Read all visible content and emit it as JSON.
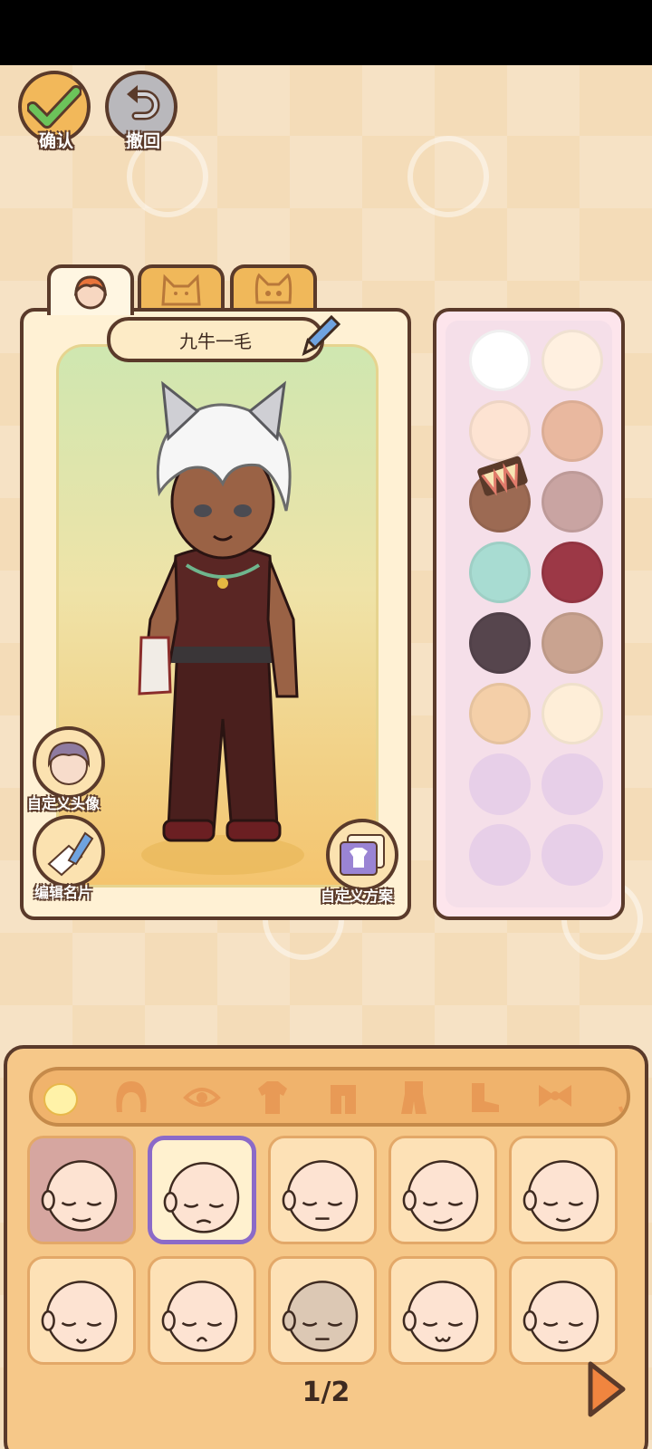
{
  "toolbar": {
    "confirm_label": "确认",
    "undo_label": "撤回"
  },
  "tabs": [
    {
      "name": "human-face-tab",
      "icon": "human-face-icon",
      "active": true
    },
    {
      "name": "cat-tab",
      "icon": "cat-face-icon",
      "active": false
    },
    {
      "name": "cat-cute-tab",
      "icon": "cat-cute-face-icon",
      "active": false
    }
  ],
  "preview": {
    "character_name": "九牛一毛",
    "custom_avatar_label": "自定义头像",
    "edit_card_label": "编辑名片",
    "custom_scheme_label": "自定义方案"
  },
  "palette": {
    "colors": [
      "#ffffff",
      "#fff0e0",
      "#fde3d2",
      "#e9b89f",
      "#9c6a53",
      "#c9a4a2",
      "#a8dcd2",
      "#9c3846",
      "#56454d",
      "#c9a390",
      "#f4cfa8",
      "#feeed8",
      "",
      "",
      "",
      ""
    ],
    "selected_index": 4
  },
  "editor": {
    "categories": [
      "body-icon",
      "hair-icon",
      "eye-icon",
      "top-icon",
      "coat-icon",
      "outfit-icon",
      "shoes-icon",
      "bow-icon",
      "accessory-icon"
    ],
    "active_category": 0,
    "selected_item": 1,
    "page": "1/2"
  }
}
